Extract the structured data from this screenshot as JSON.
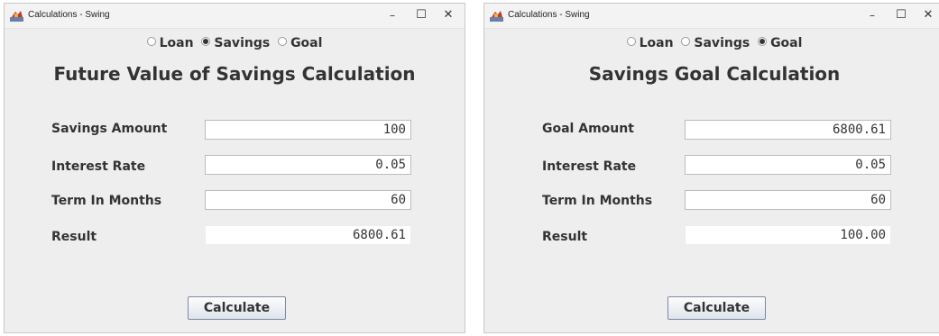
{
  "windows": [
    {
      "title": "Calculations - Swing",
      "controls": {
        "minimize": "–",
        "maximize": "☐",
        "close": "✕"
      },
      "radios": [
        {
          "label": "Loan",
          "checked": false
        },
        {
          "label": "Savings",
          "checked": true
        },
        {
          "label": "Goal",
          "checked": false
        }
      ],
      "heading": "Future Value of Savings Calculation",
      "fields": [
        {
          "label": "Savings Amount",
          "value": "100"
        },
        {
          "label": "Interest Rate",
          "value": "0.05"
        },
        {
          "label": "Term In Months",
          "value": "60"
        },
        {
          "label": "Result",
          "value": "6800.61"
        }
      ],
      "button": "Calculate"
    },
    {
      "title": "Calculations - Swing",
      "controls": {
        "minimize": "–",
        "maximize": "☐",
        "close": "✕"
      },
      "radios": [
        {
          "label": "Loan",
          "checked": false
        },
        {
          "label": "Savings",
          "checked": false
        },
        {
          "label": "Goal",
          "checked": true
        }
      ],
      "heading": "Savings Goal Calculation",
      "fields": [
        {
          "label": "Goal Amount",
          "value": "6800.61"
        },
        {
          "label": "Interest Rate",
          "value": "0.05"
        },
        {
          "label": "Term In Months",
          "value": "60"
        },
        {
          "label": "Result",
          "value": "100.00"
        }
      ],
      "button": "Calculate"
    }
  ]
}
